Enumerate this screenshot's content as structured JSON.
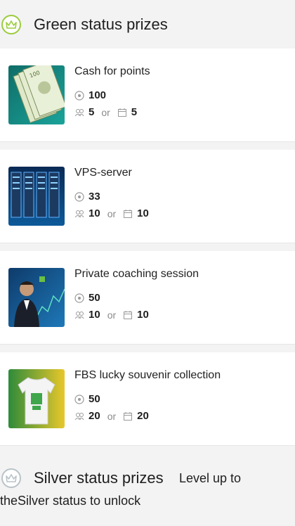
{
  "green_section": {
    "title": "Green status prizes"
  },
  "prizes": [
    {
      "title": "Cash for points",
      "points": "100",
      "referrals": "5",
      "or": "or",
      "days": "5"
    },
    {
      "title": "VPS-server",
      "points": "33",
      "referrals": "10",
      "or": "or",
      "days": "10"
    },
    {
      "title": "Private coaching session",
      "points": "50",
      "referrals": "10",
      "or": "or",
      "days": "10"
    },
    {
      "title": "FBS lucky souvenir collection",
      "points": "50",
      "referrals": "20",
      "or": "or",
      "days": "20"
    }
  ],
  "silver_section": {
    "title": "Silver status prizes",
    "note_line1": "Level up to",
    "note_line2": "theSilver status to unlock"
  },
  "colors": {
    "green": "#9ccc3d",
    "silver": "#b9c3c7",
    "background": "#f3f3f4"
  },
  "icons": [
    "crown-icon",
    "points-icon",
    "referrals-icon",
    "calendar-icon"
  ]
}
